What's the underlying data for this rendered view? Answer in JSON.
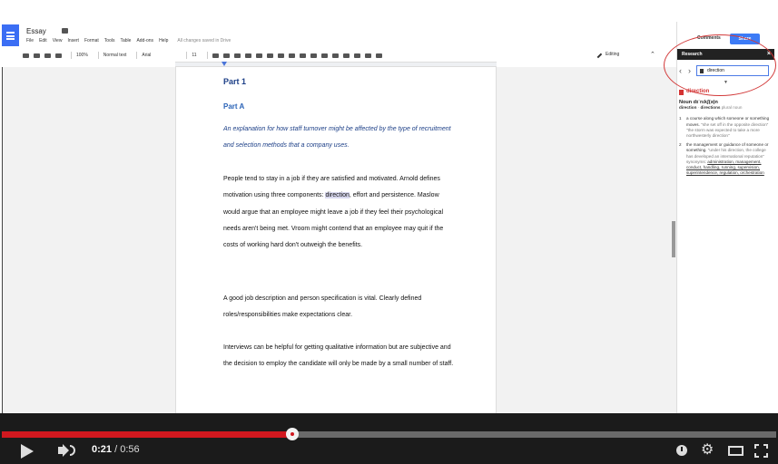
{
  "doc": {
    "title": "Essay",
    "menu": [
      "File",
      "Edit",
      "View",
      "Insert",
      "Format",
      "Tools",
      "Table",
      "Add-ons",
      "Help"
    ],
    "save_status": "All changes saved in Drive",
    "toolbar": {
      "zoom": "100%",
      "style": "Normal text",
      "font": "Arial",
      "font_size": "11",
      "editing_mode": "Editing"
    }
  },
  "content": {
    "heading1": "Part 1",
    "heading2": "Part A",
    "intro": "An explanation for how staff turnover might be affected by the type of recruitment and selection methods that a company uses.",
    "para1_before": "People tend to stay in a job if they are satisfied and motivated. Arnold defines motivation using three components: ",
    "para1_highlight": "direction",
    "para1_after": ", effort and persistence. Maslow would argue that an employee might leave a job if they feel their psychological needs aren't being met. Vroom might contend that an employee may quit if the costs of working hard don't outweigh the benefits.",
    "para2": "A good job description and person specification is vital. Clearly defined roles/responsibilities make expectations clear.",
    "para3": "Interviews can be helpful for getting qualitative information but are subjective and the decision to employ the candidate will only be made by a small number of staff."
  },
  "sidebar": {
    "comments_label": "Comments",
    "share_label": "Share",
    "research_title": "Research",
    "search_value": "direction",
    "term": "direction",
    "pos_line": "Noun  dɪˈrɛkʃ(ə)n",
    "forms_line": "direction",
    "forms_plural": "directions",
    "forms_note": "plural noun",
    "definitions": [
      {
        "num": "1",
        "text": "a course along which someone or something moves.",
        "example": "\"she set off in the opposite direction\" \"the storm was expected to take a more northwesterly direction\""
      },
      {
        "num": "2",
        "text": "the management or guidance of someone or something.",
        "example": "\"under his direction, the college has developed an international reputation\"",
        "synonyms_label": "synonyms:",
        "synonyms": "administration, management, conduct, handling, running, supervision, superintendence, regulation, orchestration"
      }
    ]
  },
  "player": {
    "current_time": "0:21",
    "duration": "/ 0:56",
    "progress": 0.375
  }
}
